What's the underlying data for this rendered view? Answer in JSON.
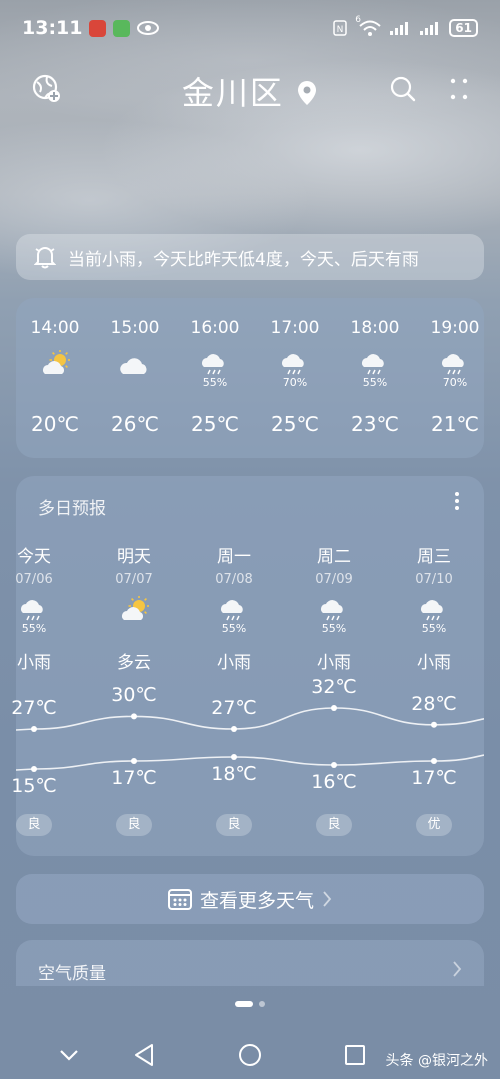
{
  "status": {
    "time": "13:11",
    "battery": "61",
    "net": "6"
  },
  "header": {
    "city": "金川区"
  },
  "banner": {
    "text": "当前小雨，今天比昨天低4度，今天、后天有雨"
  },
  "hourly": [
    {
      "time": "14:00",
      "icon": "partly-cloudy-icon",
      "pct": "",
      "temp": "20℃"
    },
    {
      "time": "15:00",
      "icon": "cloudy-icon",
      "pct": "",
      "temp": "26℃"
    },
    {
      "time": "16:00",
      "icon": "rain-icon",
      "pct": "55%",
      "temp": "25℃"
    },
    {
      "time": "17:00",
      "icon": "rain-icon",
      "pct": "70%",
      "temp": "25℃"
    },
    {
      "time": "18:00",
      "icon": "rain-icon",
      "pct": "55%",
      "temp": "23℃"
    },
    {
      "time": "19:00",
      "icon": "rain-icon",
      "pct": "70%",
      "temp": "21℃"
    }
  ],
  "daily": {
    "title": "多日预报",
    "days": [
      {
        "day": "今天",
        "date": "07/06",
        "icon": "rain-icon",
        "pct": "55%",
        "weather": "小雨",
        "high": "27℃",
        "low": "15℃",
        "high_val": 27,
        "low_val": 15,
        "aqi": "良"
      },
      {
        "day": "明天",
        "date": "07/07",
        "icon": "partly-cloudy-icon",
        "pct": "",
        "weather": "多云",
        "high": "30℃",
        "low": "17℃",
        "high_val": 30,
        "low_val": 17,
        "aqi": "良"
      },
      {
        "day": "周一",
        "date": "07/08",
        "icon": "rain-icon",
        "pct": "55%",
        "weather": "小雨",
        "high": "27℃",
        "low": "18℃",
        "high_val": 27,
        "low_val": 18,
        "aqi": "良"
      },
      {
        "day": "周二",
        "date": "07/09",
        "icon": "rain-icon",
        "pct": "55%",
        "weather": "小雨",
        "high": "32℃",
        "low": "16℃",
        "high_val": 32,
        "low_val": 16,
        "aqi": "良"
      },
      {
        "day": "周三",
        "date": "07/10",
        "icon": "rain-icon",
        "pct": "55%",
        "weather": "小雨",
        "high": "28℃",
        "low": "17℃",
        "high_val": 28,
        "low_val": 17,
        "aqi": "优"
      }
    ]
  },
  "more_button": {
    "label": "查看更多天气"
  },
  "air": {
    "title": "空气质量"
  },
  "watermark": "头条 @银河之外"
}
